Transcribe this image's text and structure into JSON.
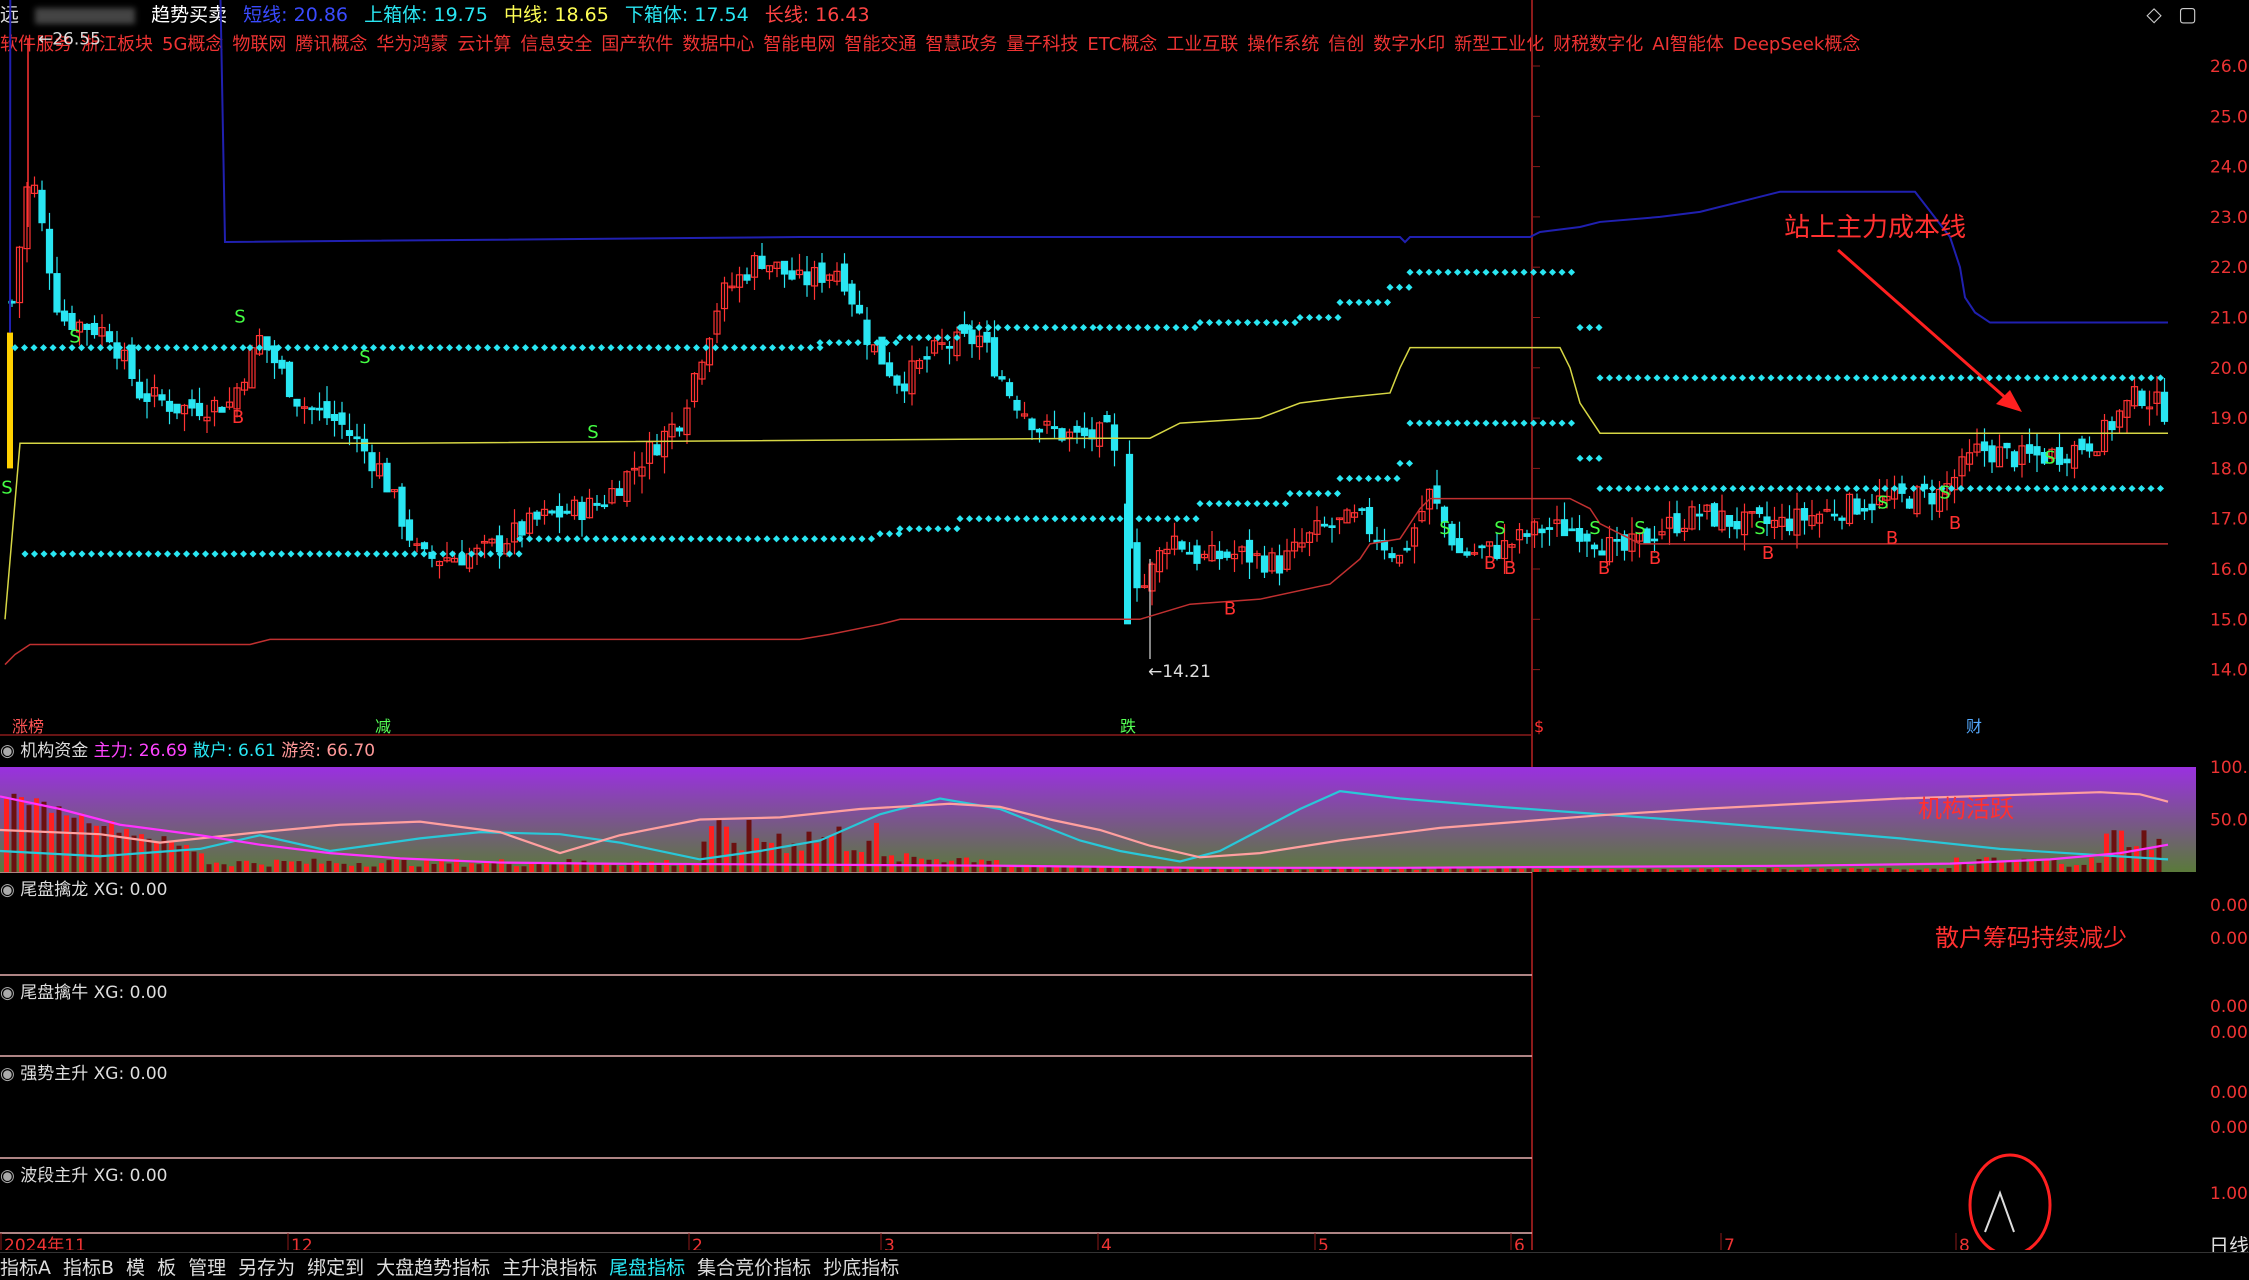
{
  "header": {
    "stock_name_prefix": "远",
    "indicator_name": "趋势买卖",
    "items": [
      {
        "label": "短线: 20.86",
        "color": "#3a4bff"
      },
      {
        "label": "上箱体: 19.75",
        "color": "#29e6f2"
      },
      {
        "label": "中线: 18.65",
        "color": "#ffff55"
      },
      {
        "label": "下箱体: 17.54",
        "color": "#29e6f2"
      },
      {
        "label": "长线: 16.43",
        "color": "#ff4444"
      }
    ]
  },
  "concepts": [
    "软件服务",
    "浙江板块",
    "5G概念",
    "物联网",
    "腾讯概念",
    "华为鸿蒙",
    "云计算",
    "信息安全",
    "国产软件",
    "数据中心",
    "智能电网",
    "智能交通",
    "智慧政务",
    "量子科技",
    "ETC概念",
    "工业互联",
    "操作系统",
    "信创",
    "数字水印",
    "新型工业化",
    "财税数字化",
    "AI智能体",
    "DeepSeek概念"
  ],
  "window_buttons": [
    "◇",
    "▢"
  ],
  "main_chart": {
    "price_axis_labels": [
      "26.00",
      "25.00",
      "24.00",
      "23.00",
      "22.00",
      "21.00",
      "20.00",
      "19.00",
      "18.00",
      "17.00",
      "16.00",
      "15.00",
      "14.00"
    ],
    "high_label": "26.55",
    "low_label": "14.21",
    "annotation": "站上主力成本线",
    "event_markers": [
      "涨榜",
      "减",
      "跌",
      "$",
      "财"
    ],
    "signal_b": "B",
    "signal_s": "S",
    "colors": {
      "up": "#ff3333",
      "down": "#29e6f2",
      "short_line": "#1a1a9a",
      "mid_line": "#d6d644",
      "long_line": "#c03030",
      "box_dots": "#29e6f2"
    }
  },
  "fund_panel": {
    "title": "机构资金",
    "items": [
      {
        "label": "主力: 26.69",
        "color": "#ff44ff"
      },
      {
        "label": "散户: 6.61",
        "color": "#29e6f2"
      },
      {
        "label": "游资: 66.70",
        "color": "#ff9999"
      }
    ],
    "axis_labels": [
      "100.00",
      "50.00"
    ],
    "annotation": "机构活跃"
  },
  "sub_panels": [
    {
      "title": "尾盘擒龙",
      "value": "XG: 0.00",
      "axis_labels": [
        "0.00",
        "0.00"
      ]
    },
    {
      "title": "尾盘擒牛",
      "value": "XG: 0.00",
      "axis_labels": [
        "0.00",
        "0.00"
      ]
    },
    {
      "title": "强势主升",
      "value": "XG: 0.00",
      "axis_labels": [
        "0.00",
        "0.00"
      ]
    },
    {
      "title": "波段主升",
      "value": "XG: 0.00",
      "axis_labels": [
        "1.00"
      ]
    }
  ],
  "retail_annotation": "散户筹码持续减少",
  "time_axis": [
    "2024年11",
    "12",
    "2",
    "3",
    "4",
    "5",
    "6",
    "7",
    "8"
  ],
  "period": "日线",
  "toolbar": [
    "指标A",
    "指标B",
    "模",
    "板",
    "管理",
    "另存为",
    "绑定到",
    "大盘趋势指标",
    "主升浪指标",
    "尾盘指标",
    "集合竞价指标",
    "抄底指标"
  ],
  "toolbar_active": "尾盘指标"
}
